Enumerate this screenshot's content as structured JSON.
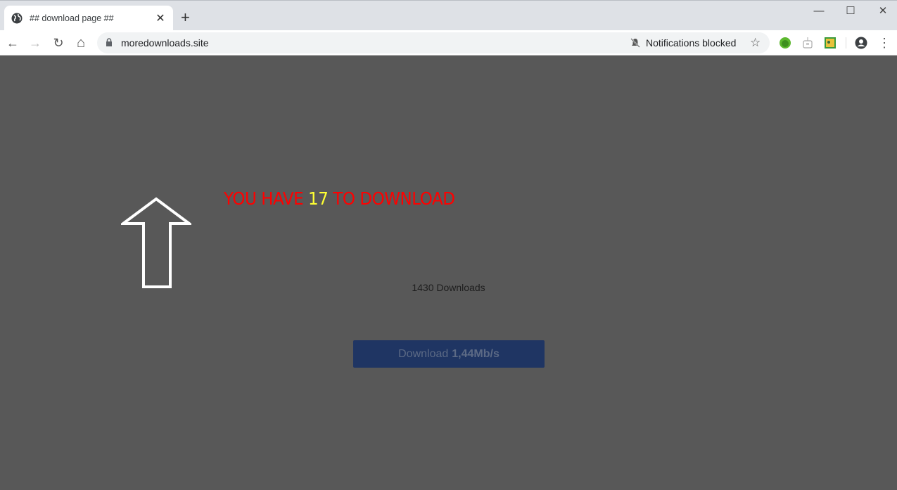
{
  "browser": {
    "tab": {
      "title": "## download page ##",
      "favicon": "globe-icon",
      "close_glyph": "✕"
    },
    "new_tab_glyph": "+",
    "window_controls": {
      "minimize": "—",
      "maximize": "☐",
      "close": "✕"
    },
    "nav": {
      "back": "←",
      "forward": "→",
      "reload": "↻",
      "home": "⌂"
    },
    "address_bar": {
      "url": "moredownloads.site",
      "secure_icon": "lock-icon"
    },
    "notification_status": "Notifications blocked",
    "bookmark_glyph": "☆",
    "extensions": [
      "green-extension-icon",
      "robot-extension-icon",
      "photo-extension-icon"
    ],
    "menu_glyph": "⋮"
  },
  "page": {
    "headline": {
      "prefix": "YOU HAVE ",
      "count": "17",
      "suffix": " TO DOWNLOAD"
    },
    "downloads_count": "1430 Downloads",
    "download_button": {
      "label": "Download",
      "speed": "1,44Mb/s"
    },
    "colors": {
      "background": "#585858",
      "headline": "#ff0000",
      "count_highlight": "#ffff33",
      "button": "#1f3563"
    }
  }
}
